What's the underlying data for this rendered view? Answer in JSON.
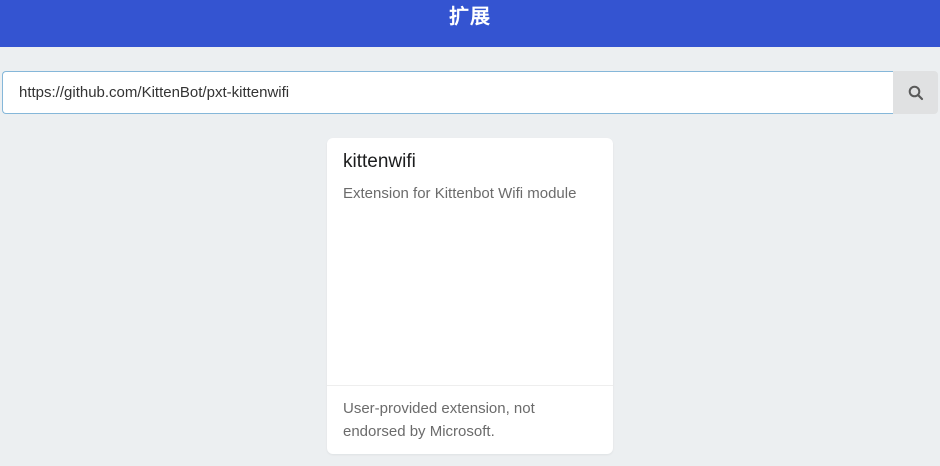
{
  "header": {
    "title": "扩展"
  },
  "search": {
    "value": "https://github.com/KittenBot/pxt-kittenwifi",
    "icon": "search-icon"
  },
  "card": {
    "title": "kittenwifi",
    "description": "Extension for Kittenbot Wifi module",
    "footer": "User-provided extension, not endorsed by Microsoft."
  },
  "colors": {
    "header_bg": "#3454d1",
    "page_bg": "#eceff1",
    "input_border": "#85b7d9",
    "button_bg": "#e0e1e2"
  }
}
